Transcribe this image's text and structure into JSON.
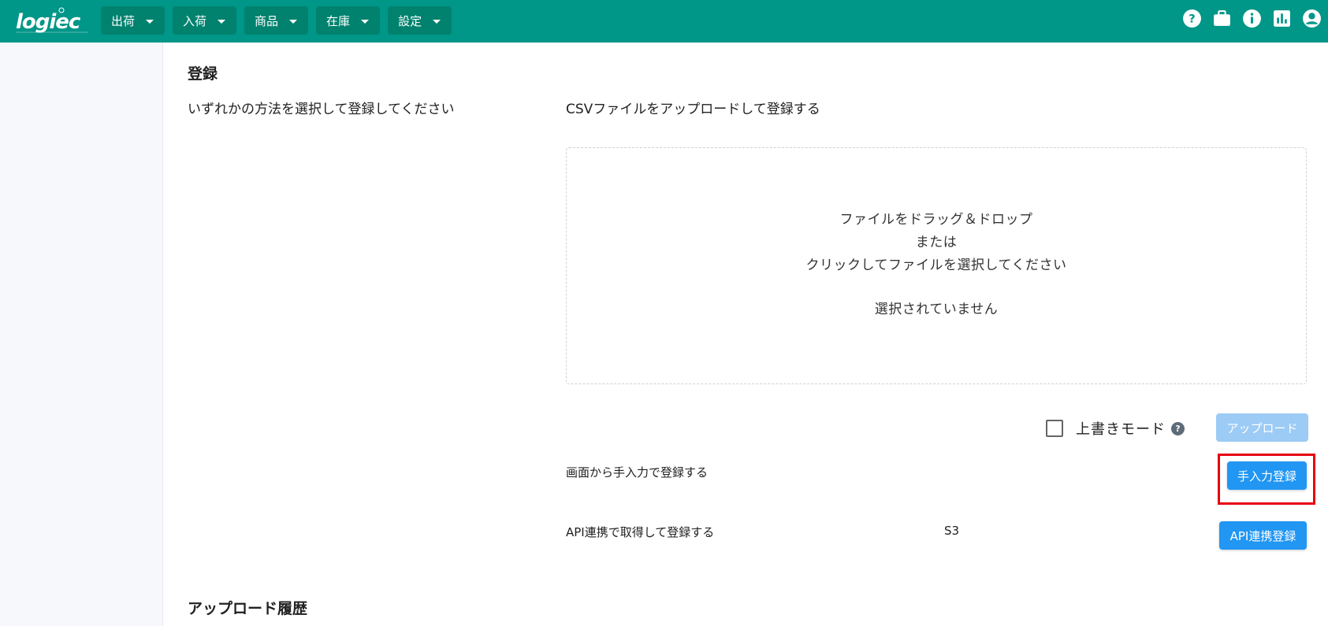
{
  "colors": {
    "accent": "#009688",
    "primary": "#2196f3",
    "highlight": "#e60012"
  },
  "header": {
    "logo": "logiec",
    "nav": [
      {
        "label": "出荷"
      },
      {
        "label": "入荷"
      },
      {
        "label": "商品"
      },
      {
        "label": "在庫"
      },
      {
        "label": "設定"
      }
    ],
    "icons": [
      "help-icon",
      "briefcase-icon",
      "info-icon",
      "chart-icon",
      "account-icon"
    ]
  },
  "main": {
    "section_title": "登録",
    "instruction": "いずれかの方法を選択して登録してください",
    "csv": {
      "title": "CSVファイルをアップロードして登録する",
      "dropzone_line1": "ファイルをドラッグ＆ドロップ",
      "dropzone_line2": "または",
      "dropzone_line3": "クリックしてファイルを選択してください",
      "selected_status": "選択されていません",
      "overwrite_label": "上書きモード",
      "overwrite_checked": false,
      "help_glyph": "?",
      "upload_button": "アップロード"
    },
    "manual": {
      "label": "画面から手入力で登録する",
      "button": "手入力登録"
    },
    "api": {
      "label": "API連携で取得して登録する",
      "source": "S3",
      "button": "API連携登録"
    },
    "history_title": "アップロード履歴"
  }
}
